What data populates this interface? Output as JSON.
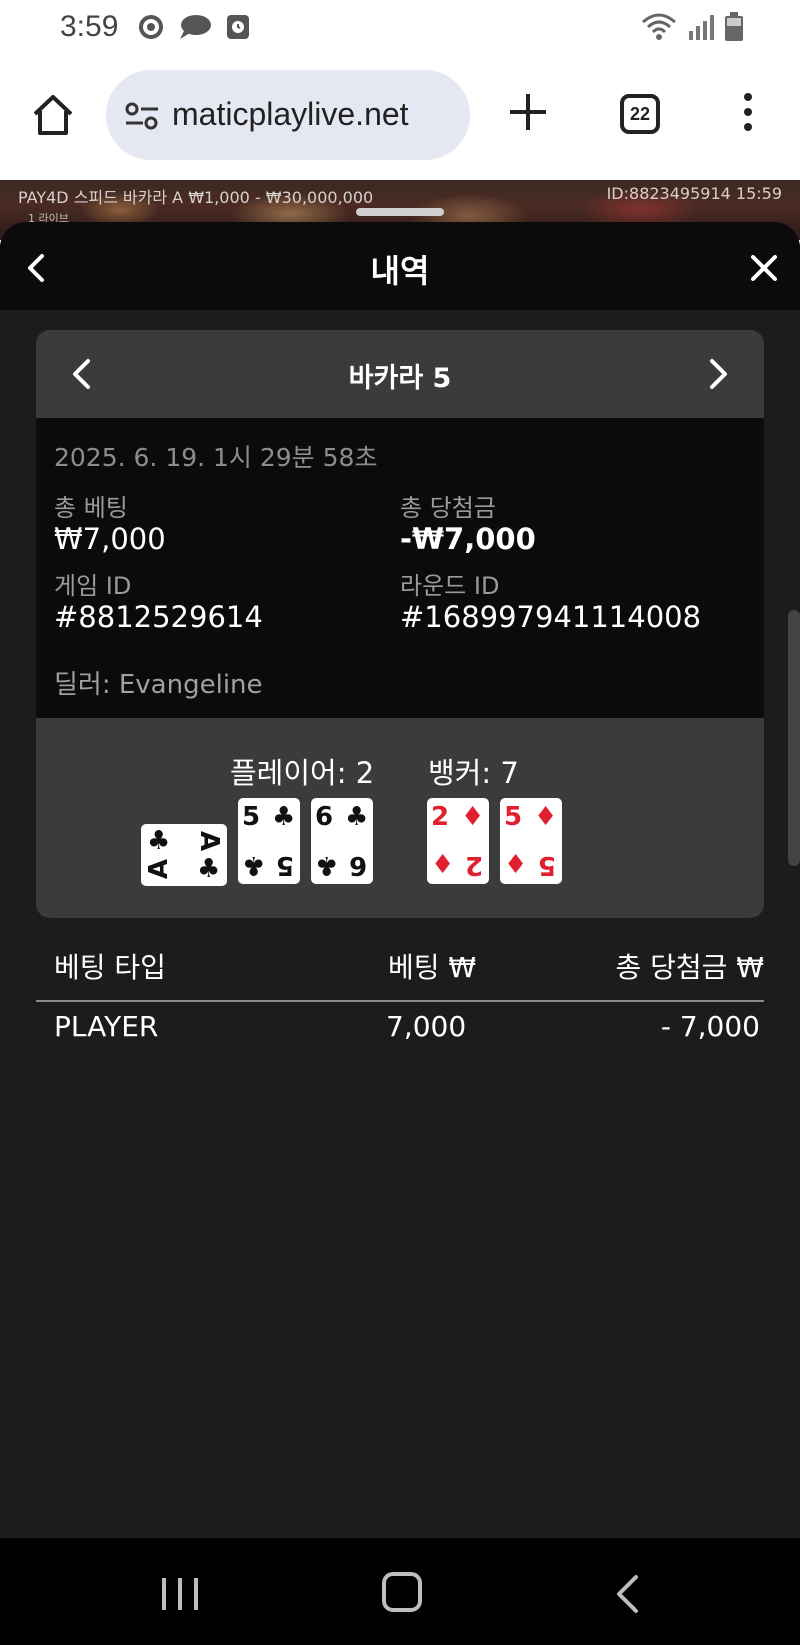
{
  "status_bar": {
    "time": "3:59"
  },
  "browser": {
    "url": "maticplaylive.net",
    "tab_count": "22"
  },
  "game_strip": {
    "info_left": "PAY4D 스피드 바카라 A   ₩1,000 - ₩30,000,000",
    "info_right": "ID:8823495914   15:59",
    "sub": "1 라이브"
  },
  "sheet": {
    "title": "내역",
    "card_title": "바카라 5",
    "date": "2025. 6. 19. 1시 29분 58초",
    "total_bet_label": "총 베팅",
    "total_bet_value": "₩7,000",
    "total_win_label": "총 당첨금",
    "total_win_value": "-₩7,000",
    "game_id_label": "게임 ID",
    "game_id_value": "#8812529614",
    "round_id_label": "라운드 ID",
    "round_id_value": "#168997941114008",
    "dealer": "딜러: Evangeline",
    "player_label": "플레이어: 2",
    "banker_label": "뱅커: 7",
    "player_cards": [
      {
        "rank": "A",
        "suit": "♣",
        "color": "black",
        "orientation": "sideways"
      },
      {
        "rank": "5",
        "suit": "♣",
        "color": "black",
        "orientation": "upright"
      },
      {
        "rank": "6",
        "suit": "♣",
        "color": "black",
        "orientation": "upright"
      }
    ],
    "banker_cards": [
      {
        "rank": "2",
        "suit": "♦",
        "color": "red",
        "orientation": "upright"
      },
      {
        "rank": "5",
        "suit": "♦",
        "color": "red",
        "orientation": "upright"
      }
    ],
    "table": {
      "headers": [
        "베팅 타입",
        "베팅 ₩",
        "총 당첨금 ₩"
      ],
      "rows": [
        {
          "type": "PLAYER",
          "bet": "7,000",
          "win": "- 7,000"
        }
      ]
    }
  }
}
